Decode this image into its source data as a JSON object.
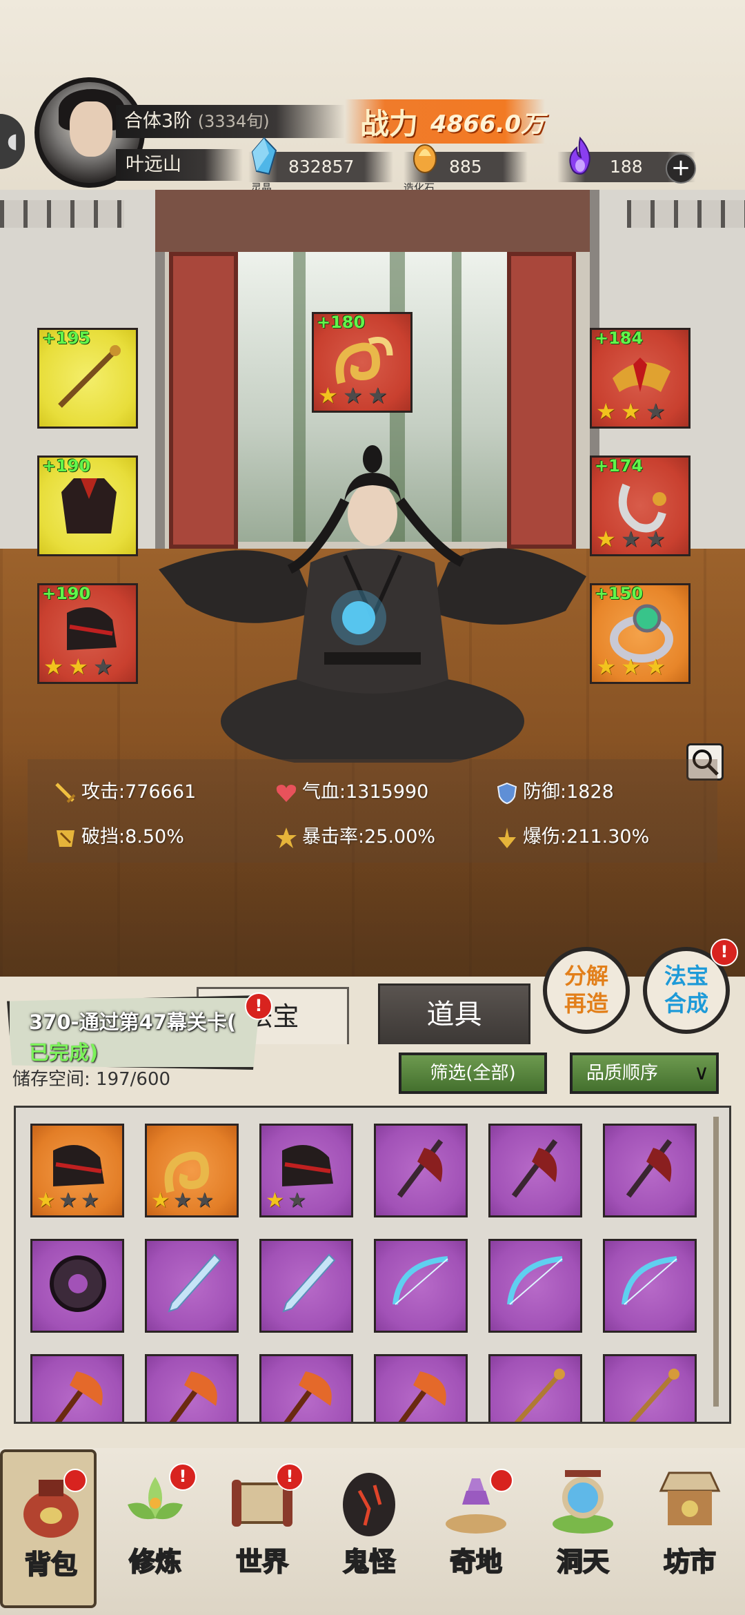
{
  "header": {
    "realm": "合体3阶",
    "realm_detail": "(3334旬)",
    "player_name": "叶远山",
    "power_label": "战力",
    "power_value": "4866.0万",
    "resources": [
      {
        "icon": "spirit-crystal-icon",
        "caption": "灵晶",
        "value": "832857"
      },
      {
        "icon": "creation-stone-icon",
        "caption": "造化石",
        "value": "885"
      },
      {
        "icon": "purple-flame-icon",
        "caption": "",
        "value": "188"
      }
    ],
    "add_label": "+"
  },
  "equipment": {
    "left": [
      {
        "bonus": "+195",
        "rarity": "yellow",
        "icon": "staff-icon",
        "stars": 0
      },
      {
        "bonus": "+190",
        "rarity": "yellow",
        "icon": "robe-icon",
        "stars": 0
      },
      {
        "bonus": "+190",
        "rarity": "red",
        "icon": "boots-icon",
        "stars": 2
      }
    ],
    "center": {
      "bonus": "+180",
      "rarity": "red",
      "icon": "golden-dragon-icon",
      "stars": 1
    },
    "right": [
      {
        "bonus": "+184",
        "rarity": "red",
        "icon": "crown-icon",
        "stars": 2
      },
      {
        "bonus": "+174",
        "rarity": "red",
        "icon": "pendant-icon",
        "stars": 1
      },
      {
        "bonus": "+150",
        "rarity": "orange",
        "icon": "ring-icon",
        "stars": 3
      }
    ]
  },
  "stats": [
    {
      "icon": "sword-icon",
      "label": "攻击:",
      "value": "776661"
    },
    {
      "icon": "heart-icon",
      "label": "气血:",
      "value": "1315990"
    },
    {
      "icon": "shield-icon",
      "label": "防御:",
      "value": "1828"
    },
    {
      "icon": "break-icon",
      "label": "破挡:",
      "value": "8.50%"
    },
    {
      "icon": "crit-icon",
      "label": "暴击率:",
      "value": "25.00%"
    },
    {
      "icon": "crit-damage-icon",
      "label": "爆伤:",
      "value": "211.30%"
    }
  ],
  "tabs": {
    "fabao": "法宝",
    "daoju": "道具"
  },
  "action_buttons": {
    "fenjie": [
      "分解",
      "再造"
    ],
    "hecheng": [
      "法宝",
      "合成"
    ],
    "badge": "!"
  },
  "quest": {
    "title": "370-通过第47幕关卡(",
    "status": "已完成)"
  },
  "storage": "储存空间: 197/600",
  "filter_label": "筛选(全部)",
  "sort_label": "品质顺序",
  "inventory": [
    {
      "rarity": "orange",
      "icon": "boots-icon",
      "stars": 1
    },
    {
      "rarity": "orange",
      "icon": "golden-dragon-icon",
      "stars": 1
    },
    {
      "rarity": "purple",
      "icon": "boots-icon",
      "stars": 1
    },
    {
      "rarity": "purple",
      "icon": "dark-axe-icon",
      "stars": 0
    },
    {
      "rarity": "purple",
      "icon": "dark-axe-icon",
      "stars": 0
    },
    {
      "rarity": "purple",
      "icon": "dark-axe-icon",
      "stars": 0
    },
    {
      "rarity": "purple",
      "icon": "chakram-icon",
      "stars": 0
    },
    {
      "rarity": "purple",
      "icon": "ice-sword-icon",
      "stars": 0
    },
    {
      "rarity": "purple",
      "icon": "ice-sword-icon",
      "stars": 0
    },
    {
      "rarity": "purple",
      "icon": "bow-icon",
      "stars": 0
    },
    {
      "rarity": "purple",
      "icon": "bow-icon",
      "stars": 0
    },
    {
      "rarity": "purple",
      "icon": "bow-icon",
      "stars": 0
    },
    {
      "rarity": "purple",
      "icon": "fire-axe-icon",
      "stars": 0
    },
    {
      "rarity": "purple",
      "icon": "fire-axe-icon",
      "stars": 0
    },
    {
      "rarity": "purple",
      "icon": "fire-axe-icon",
      "stars": 0
    },
    {
      "rarity": "purple",
      "icon": "fire-axe-icon",
      "stars": 0
    },
    {
      "rarity": "purple",
      "icon": "staff-icon",
      "stars": 0
    },
    {
      "rarity": "purple",
      "icon": "staff-icon",
      "stars": 0
    }
  ],
  "nav": [
    {
      "label": "背包",
      "icon": "bag-icon",
      "badge": ""
    },
    {
      "label": "修炼",
      "icon": "lotus-icon",
      "badge": "!"
    },
    {
      "label": "世界",
      "icon": "scroll-icon",
      "badge": "!"
    },
    {
      "label": "鬼怪",
      "icon": "demon-egg-icon",
      "badge": ""
    },
    {
      "label": "奇地",
      "icon": "pagoda-icon",
      "badge": ""
    },
    {
      "label": "洞天",
      "icon": "portal-icon",
      "badge": ""
    },
    {
      "label": "坊市",
      "icon": "market-icon",
      "badge": ""
    }
  ],
  "colors": {
    "slot_yellow": "#e8de3b",
    "slot_red": "#c9402f",
    "slot_orange": "#e8862a",
    "cell_purple": "#a252b7",
    "bonus_green": "#62f54b",
    "power_orange": "#f27a23"
  }
}
